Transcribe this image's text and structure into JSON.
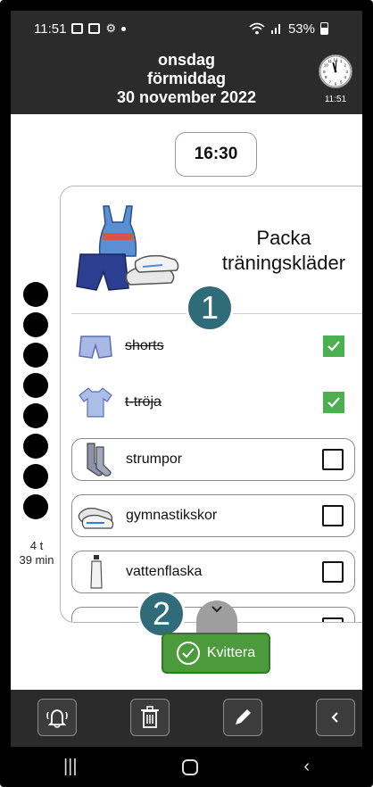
{
  "status_bar": {
    "time": "11:51",
    "battery": "53%",
    "icons": [
      "photo-icon",
      "record-icon",
      "settings-icon",
      "wifi-icon",
      "signal-icon",
      "battery-icon"
    ]
  },
  "header": {
    "day": "onsdag",
    "part_of_day": "förmiddag",
    "date": "30 november 2022",
    "clock_time": "11:51"
  },
  "activity": {
    "time": "16:30",
    "remaining": "4 t\n39 min",
    "remaining_line1": "4 t",
    "remaining_line2": "39 min",
    "dot_count": 8,
    "title_line1": "Packa",
    "title_line2": "träningskläder"
  },
  "checklist": [
    {
      "label": "shorts",
      "done": true,
      "icon": "shorts-icon"
    },
    {
      "label": "t-tröja",
      "done": true,
      "icon": "tshirt-icon"
    },
    {
      "label": "strumpor",
      "done": false,
      "icon": "socks-icon"
    },
    {
      "label": "gymnastikskor",
      "done": false,
      "icon": "sneakers-icon"
    },
    {
      "label": "vattenflaska",
      "done": false,
      "icon": "water-bottle-icon"
    }
  ],
  "badges": {
    "first": "1",
    "second": "2"
  },
  "buttons": {
    "acknowledge": "Kvittera"
  },
  "toolbar": {
    "icons": [
      "alarm-bell-icon",
      "trash-icon",
      "pencil-icon",
      "chevron-left-icon"
    ]
  },
  "colors": {
    "bar_bg": "#2b2b2b",
    "accent_green": "#4b9a3c",
    "badge_teal": "#2f6b78"
  }
}
